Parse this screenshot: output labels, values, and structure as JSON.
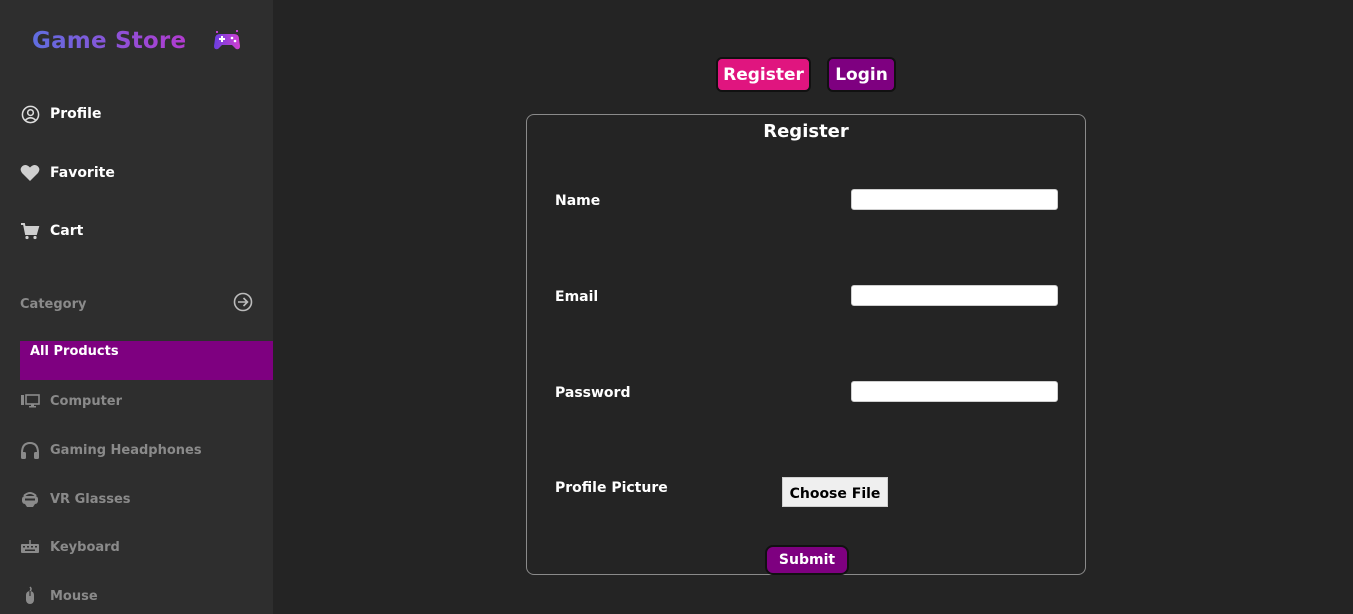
{
  "app": {
    "title": "Game Store",
    "logo_icon": "gamepad-icon"
  },
  "sidebar": {
    "nav": [
      {
        "label": "Profile",
        "icon": "user-circle-icon"
      },
      {
        "label": "Favorite",
        "icon": "heart-icon"
      },
      {
        "label": "Cart",
        "icon": "cart-icon"
      }
    ],
    "category_label": "Category",
    "category_icon": "arrow-right-circle-icon",
    "categories": [
      {
        "label": "All Products",
        "active": true
      },
      {
        "label": "Computer",
        "icon": "monitor-icon"
      },
      {
        "label": "Gaming Headphones",
        "icon": "headphones-icon"
      },
      {
        "label": "VR Glasses",
        "icon": "vr-headset-icon"
      },
      {
        "label": "Keyboard",
        "icon": "keyboard-icon"
      },
      {
        "label": "Mouse",
        "icon": "mouse-icon"
      }
    ]
  },
  "tabs": {
    "register": "Register",
    "login": "Login"
  },
  "form": {
    "title": "Register",
    "fields": [
      {
        "label": "Name",
        "value": ""
      },
      {
        "label": "Email",
        "value": ""
      },
      {
        "label": "Password",
        "value": ""
      }
    ],
    "picture_label": "Profile Picture",
    "file_button": "Choose File",
    "submit": "Submit"
  },
  "colors": {
    "accent_purple": "#7e0080",
    "accent_pink": "#e0157f",
    "background": "#242424",
    "sidebar": "#2e2e2e"
  }
}
